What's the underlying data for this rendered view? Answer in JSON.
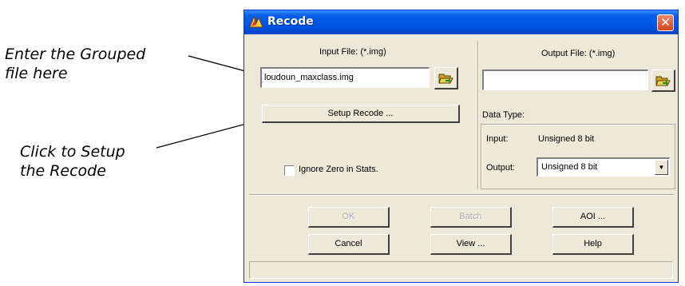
{
  "callouts": {
    "grouped_line1": "Enter the Grouped",
    "grouped_line2": "file here",
    "setup_line1": "Click to Setup",
    "setup_line2": "the Recode"
  },
  "window": {
    "title": "Recode",
    "close_glyph": "✕"
  },
  "input": {
    "label": "Input File: (*.img)",
    "value": "loudoun_maxclass.img",
    "browse_icon": "folder-open-icon"
  },
  "output": {
    "label": "Output File: (*.img)",
    "value": "",
    "browse_icon": "folder-open-icon"
  },
  "setup_button": "Setup Recode ...",
  "ignore_zero": {
    "label": "Ignore Zero in Stats.",
    "checked": false
  },
  "data_type": {
    "label": "Data Type:",
    "input_label": "Input:",
    "input_value": "Unsigned 8 bit",
    "output_label": "Output:",
    "output_value": "Unsigned 8 bit"
  },
  "buttons": {
    "ok": "OK",
    "batch": "Batch",
    "aoi": "AOI ...",
    "cancel": "Cancel",
    "view": "View ...",
    "help": "Help"
  },
  "colors": {
    "titlebar": "#0055e5",
    "dialog_bg": "#ece9d8",
    "close_button": "#d3431f"
  }
}
